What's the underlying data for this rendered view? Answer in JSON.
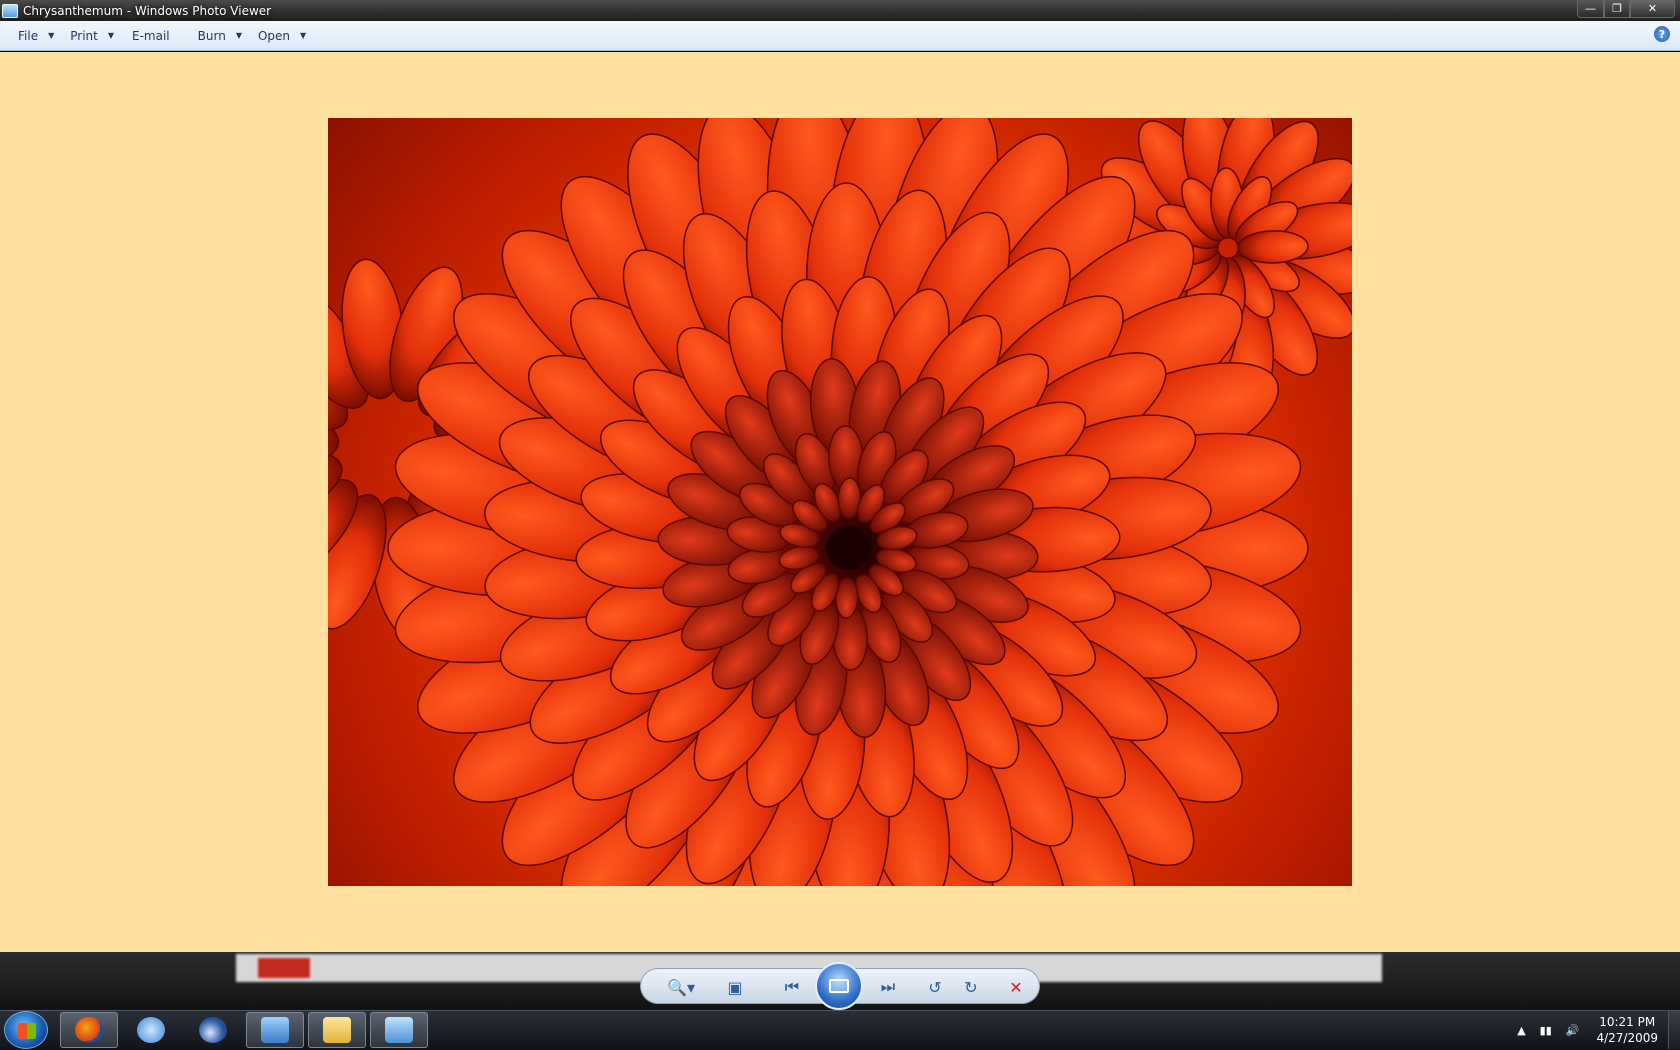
{
  "window": {
    "title": "Chrysanthemum - Windows Photo Viewer",
    "controls": {
      "minimize_icon": "minimize-icon",
      "maximize_icon": "restore-icon",
      "close_icon": "close-icon"
    }
  },
  "menu": {
    "items": [
      {
        "label": "File",
        "has_dropdown": true
      },
      {
        "label": "Print",
        "has_dropdown": true
      },
      {
        "label": "E-mail",
        "has_dropdown": false
      },
      {
        "label": "Burn",
        "has_dropdown": true
      },
      {
        "label": "Open",
        "has_dropdown": true
      }
    ],
    "help_icon": "help-icon"
  },
  "viewer": {
    "background_color": "#ffe09e",
    "photo": {
      "subject": "red chrysanthemum flower",
      "dominant_color": "#e0300a"
    }
  },
  "controls": [
    {
      "name": "zoom-button",
      "icon": "magnifier-icon"
    },
    {
      "name": "actual-size-button",
      "icon": "fit-window-icon"
    },
    {
      "name": "previous-button",
      "icon": "previous-icon"
    },
    {
      "name": "slideshow-button",
      "icon": "slideshow-icon"
    },
    {
      "name": "next-button",
      "icon": "next-icon"
    },
    {
      "name": "rotate-ccw-button",
      "icon": "rotate-counterclockwise-icon"
    },
    {
      "name": "rotate-cw-button",
      "icon": "rotate-clockwise-icon"
    },
    {
      "name": "delete-button",
      "icon": "delete-icon"
    }
  ],
  "taskbar": {
    "start_icon": "windows-start-icon",
    "apps": [
      {
        "name": "firefox",
        "icon": "firefox-icon",
        "active": true
      },
      {
        "name": "itunes",
        "icon": "itunes-icon",
        "active": false
      },
      {
        "name": "thunderbird",
        "icon": "thunderbird-icon",
        "active": false
      },
      {
        "name": "control-panel",
        "icon": "control-panel-icon",
        "active": true
      },
      {
        "name": "explorer",
        "icon": "folder-icon",
        "active": true
      },
      {
        "name": "photo-viewer",
        "icon": "photo-viewer-icon",
        "active": true
      }
    ],
    "tray": {
      "time": "10:21 PM",
      "date": "4/27/2009"
    }
  }
}
